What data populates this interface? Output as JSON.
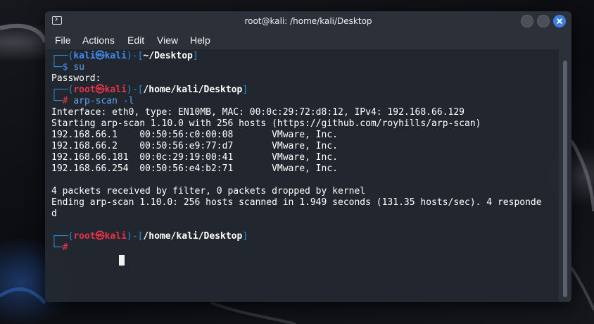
{
  "window": {
    "title": "root@kali: /home/kali/Desktop"
  },
  "menu": [
    "File",
    "Actions",
    "Edit",
    "View",
    "Help"
  ],
  "prompt1": {
    "open": "┌──(",
    "user": "kali㉿kali",
    "close": ")-[",
    "path": "~/Desktop",
    "end": "]",
    "lead": "└─",
    "symbol": "$",
    "command": "su"
  },
  "password_line": "Password:",
  "prompt2": {
    "open": "┌──(",
    "user": "root㉿kali",
    "close": ")-[",
    "path": "/home/kali/Desktop",
    "end": "]",
    "lead": "└─",
    "symbol": "#",
    "command": "arp-scan -l"
  },
  "output": [
    "Interface: eth0, type: EN10MB, MAC: 00:0c:29:72:d8:12, IPv4: 192.168.66.129",
    "Starting arp-scan 1.10.0 with 256 hosts (https://github.com/royhills/arp-scan)",
    "192.168.66.1    00:50:56:c0:00:08       VMware, Inc.",
    "192.168.66.2    00:50:56:e9:77:d7       VMware, Inc.",
    "192.168.66.181  00:0c:29:19:00:41       VMware, Inc.",
    "192.168.66.254  00:50:56:e4:b2:71       VMware, Inc.",
    "",
    "4 packets received by filter, 0 packets dropped by kernel",
    "Ending arp-scan 1.10.0: 256 hosts scanned in 1.949 seconds (131.35 hosts/sec). 4 responde",
    "d"
  ],
  "prompt3": {
    "open": "┌──(",
    "user": "root㉿kali",
    "close": ")-[",
    "path": "/home/kali/Desktop",
    "end": "]",
    "lead": "└─",
    "symbol": "#",
    "command": ""
  },
  "icons": {
    "app": "terminal-icon",
    "minimize": "minimize-icon",
    "maximize": "maximize-icon",
    "close": "close-icon"
  },
  "colors": {
    "accent_blue": "#3f8ef5",
    "root_red": "#e8334a",
    "close_button": "#3d7fe0"
  }
}
